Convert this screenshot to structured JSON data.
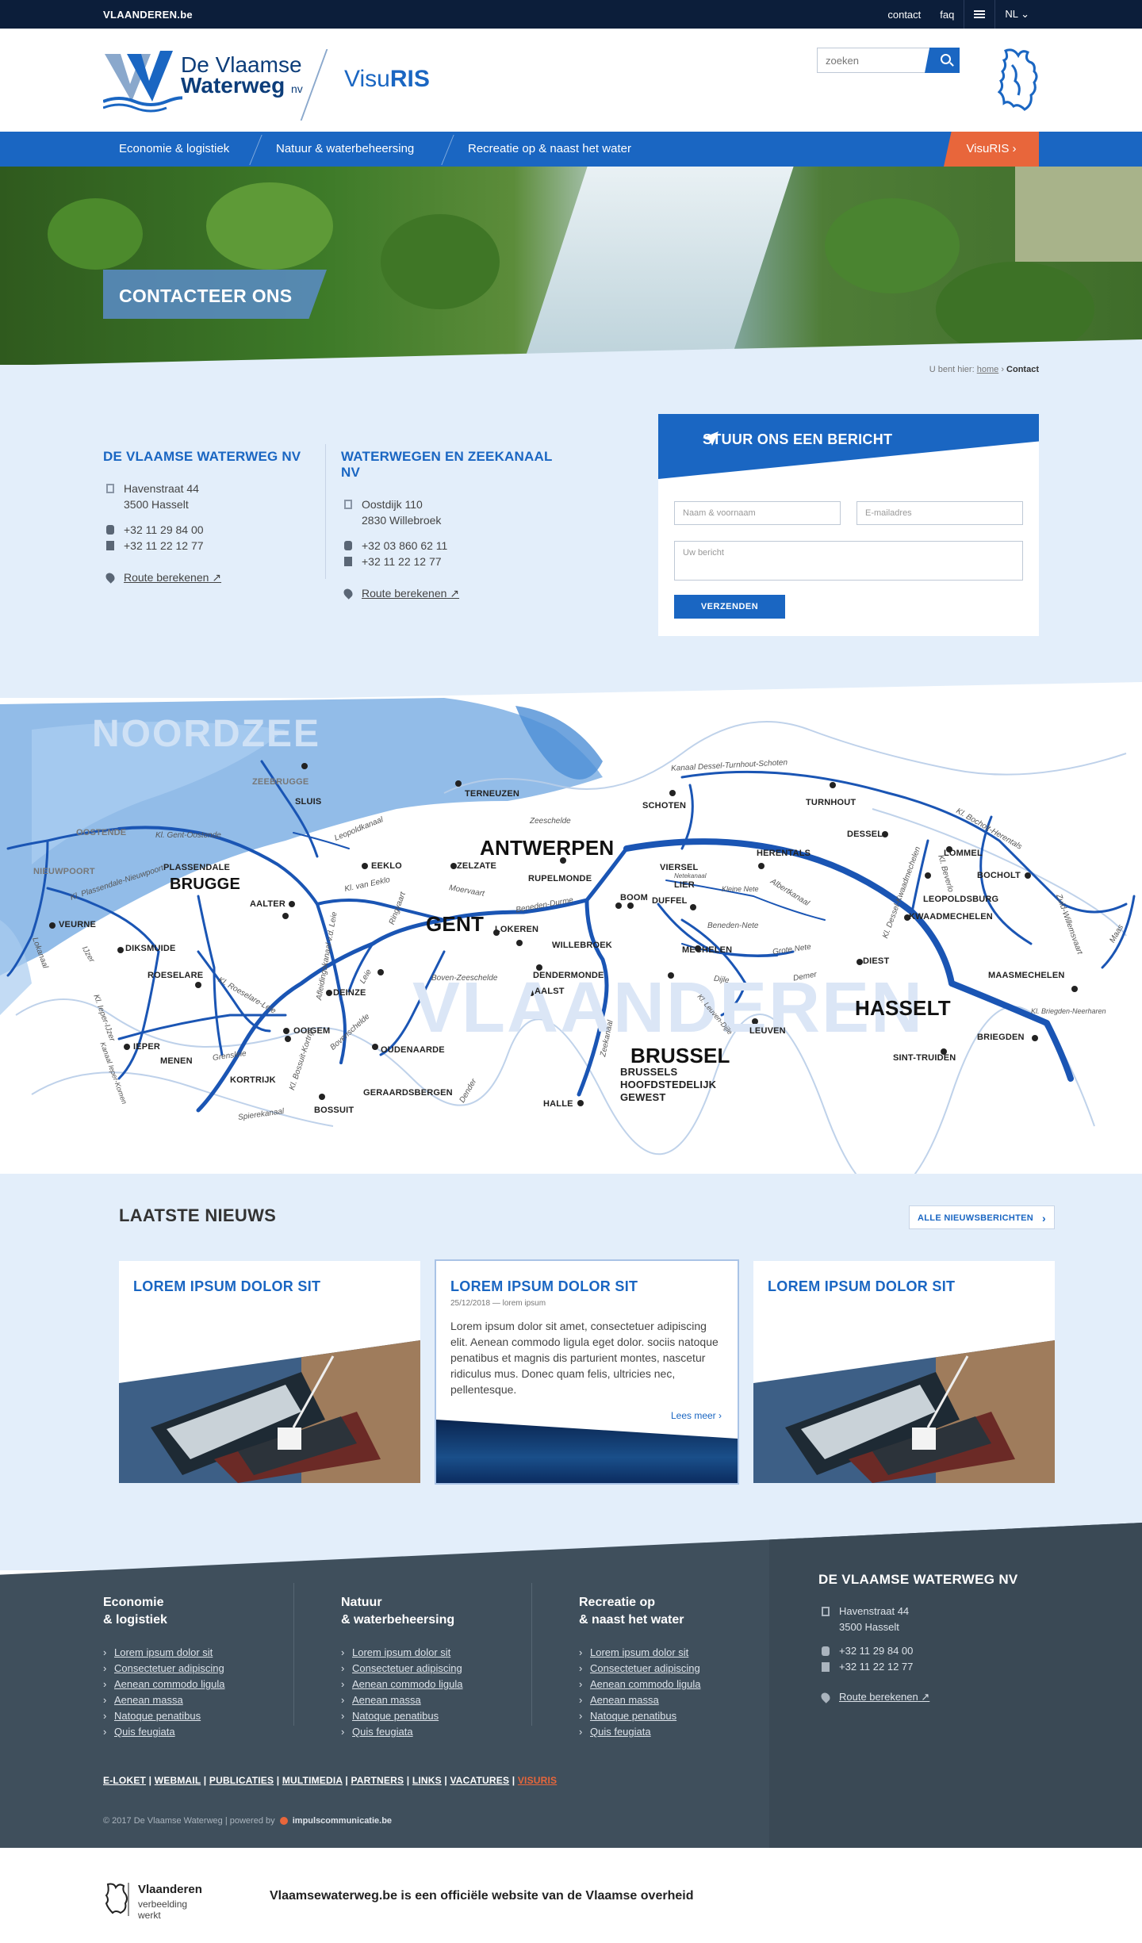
{
  "topbar": {
    "brand": "VLAANDEREN.be",
    "contact": "contact",
    "faq": "faq",
    "lang": "NL ⌄"
  },
  "header": {
    "logo_line1": "De Vlaamse",
    "logo_line2": "Waterweg",
    "logo_nv": "nv",
    "app_prefix": "Visu",
    "app_suffix": "RIS",
    "search_placeholder": "zoeken"
  },
  "nav": {
    "items": [
      "Economie & logistiek",
      "Natuur & waterbeheersing",
      "Recreatie op & naast het water"
    ],
    "visuris": "VisuRIS ›"
  },
  "hero": {
    "title": "CONTACTEER ONS"
  },
  "breadcrumb": {
    "prefix": "U bent hier:",
    "home": "home",
    "sep": "›",
    "current": "Contact"
  },
  "contacts": [
    {
      "name": "DE VLAAMSE WATERWEG NV",
      "street": "Havenstraat 44",
      "city": "3500 Hasselt",
      "phone": "+32 11 29 84 00",
      "fax": "+32 11 22 12 77",
      "route": "Route berekenen"
    },
    {
      "name": "WATERWEGEN EN ZEEKANAAL NV",
      "street": "Oostdijk 110",
      "city": "2830 Willebroek",
      "phone": "+32 03 860 62 11",
      "fax": "+32 11 22 12 77",
      "route": "Route berekenen"
    }
  ],
  "form": {
    "title": "STUUR ONS EEN BERICHT",
    "name_placeholder": "Naam & voornaam",
    "email_placeholder": "E-mailadres",
    "message_placeholder": "Uw bericht",
    "submit": "VERZENDEN"
  },
  "map": {
    "sea": "NOORDZEE",
    "region": "VLAANDEREN",
    "cities_big": {
      "antwerpen": "ANTWERPEN",
      "brugge": "BRUGGE",
      "gent": "GENT",
      "hasselt": "HASSELT",
      "brussel": "BRUSSEL"
    },
    "brussel_sub": [
      "BRUSSELS",
      "HOOFDSTEDELIJK",
      "GEWEST"
    ],
    "places": [
      "ZEEBRUGGE",
      "SLUIS",
      "OOSTENDE",
      "NIEUWPOORT",
      "PLASSENDALE",
      "VEURNE",
      "DIKSMUIDE",
      "ROESELARE",
      "IEPER",
      "MENEN",
      "KORTRIJK",
      "BOSSUIT",
      "OOIGEM",
      "DEINZE",
      "AALTER",
      "EEKLO",
      "ZELZATE",
      "TERNEUZEN",
      "LOKEREN",
      "WILLEBROEK",
      "DENDERMONDE",
      "AALST",
      "OUDENAARDE",
      "GERAARDSBERGEN",
      "HALLE",
      "RUPELMONDE",
      "BOOM",
      "DUFFEL",
      "LIER",
      "VIERSEL",
      "MECHELEN",
      "LEUVEN",
      "SCHOTEN",
      "TURNHOUT",
      "HERENTALS",
      "DESSEL",
      "LOMMEL",
      "BOCHOLT",
      "LEOPOLDSBURG",
      "KWAADMECHELEN",
      "DIEST",
      "MAASMECHELEN",
      "BRIEGDEN",
      "SINT-TRUIDEN"
    ],
    "canals": [
      "Kanaal Dessel-Turnhout-Schoten",
      "Zeeschelde",
      "Kl. Gent-Oostende",
      "Leopoldkanaal",
      "Albertkanaal",
      "Beneden-Nete",
      "Boven-Zeeschelde",
      "Beneden-Durme",
      "Dijle",
      "Demer",
      "Zuid-Willemsvaart",
      "Maas",
      "Grensleie",
      "Spierekanaal",
      "Dender",
      "Kl. Roeselare-Leie",
      "Kl. Bossuit-Kortrijk",
      "Zeekanaal",
      "Kl. Plassendale-Nieuwpoort",
      "Ringvaart",
      "Moervaart",
      "Grote Nete",
      "Kleine Nete",
      "Kl. Bocholt-Herentals",
      "Kl. Briegden-Neerharen",
      "Kl. Dessel-Kwaadmechelen",
      "Kl. Beverlo",
      "Afleidingskanaal v.d. Leie",
      "Kl. van Eeklo",
      "Bovenschelde",
      "Netekanaal",
      "Lokanaal",
      "IJzer",
      "Kl. Ieper-IJzer",
      "Kanaal Ieper-Komen",
      "Leie",
      "Kl. Leuven-Dijle"
    ]
  },
  "news": {
    "title": "LAATSTE NIEUWS",
    "all": "ALLE NIEUWSBERICHTEN",
    "items": [
      {
        "title": "LOREM IPSUM DOLOR SIT"
      },
      {
        "title": "LOREM IPSUM DOLOR SIT",
        "meta": "25/12/2018 — lorem ipsum",
        "text": "Lorem ipsum dolor sit amet, consectetuer adipiscing elit. Aenean commodo ligula eget dolor. sociis natoque penatibus et magnis dis parturient montes, nascetur ridiculus mus. Donec quam felis, ultricies nec, pellentesque.",
        "more": "Lees meer ›"
      },
      {
        "title": "LOREM IPSUM DOLOR SIT"
      }
    ]
  },
  "footer": {
    "cols": [
      {
        "title1": "Economie",
        "title2": "& logistiek",
        "links": [
          "Lorem ipsum dolor sit",
          "Consectetuer adipiscing",
          "Aenean commodo ligula",
          "Aenean massa",
          "Natoque penatibus",
          "Quis feugiata"
        ]
      },
      {
        "title1": "Natuur",
        "title2": "& waterbeheersing",
        "links": [
          "Lorem ipsum dolor sit",
          "Consectetuer adipiscing",
          "Aenean commodo ligula",
          "Aenean massa",
          "Natoque penatibus",
          "Quis feugiata"
        ]
      },
      {
        "title1": "Recreatie op",
        "title2": "& naast het water",
        "links": [
          "Lorem ipsum dolor sit",
          "Consectetuer adipiscing",
          "Aenean commodo ligula",
          "Aenean massa",
          "Natoque penatibus",
          "Quis feugiata"
        ]
      }
    ],
    "org": {
      "name": "DE VLAAMSE WATERWEG NV",
      "street": "Havenstraat 44",
      "city": "3500 Hasselt",
      "phone": "+32 11 29 84 00",
      "fax": "+32 11 22 12 77",
      "route": "Route berekenen"
    },
    "links": [
      "E-LOKET",
      "WEBMAIL",
      "PUBLICATIES",
      "MULTIMEDIA",
      "PARTNERS",
      "LINKS",
      "VACATURES",
      "VISURIS"
    ],
    "copyright": "© 2017 De Vlaamse Waterweg | powered by",
    "powered": "impulscommunicatie.be"
  },
  "bottom": {
    "vl_name": "Vlaanderen",
    "vl_tag": "verbeelding werkt",
    "message": "Vlaamsewaterweg.be is een officiële website van de Vlaamse overheid"
  },
  "colors": {
    "primary": "#1a66c2",
    "accent": "#e8663b",
    "dark": "#0c1e3a",
    "footer": "#3f4f5c",
    "light_bg": "#e3eefa"
  }
}
